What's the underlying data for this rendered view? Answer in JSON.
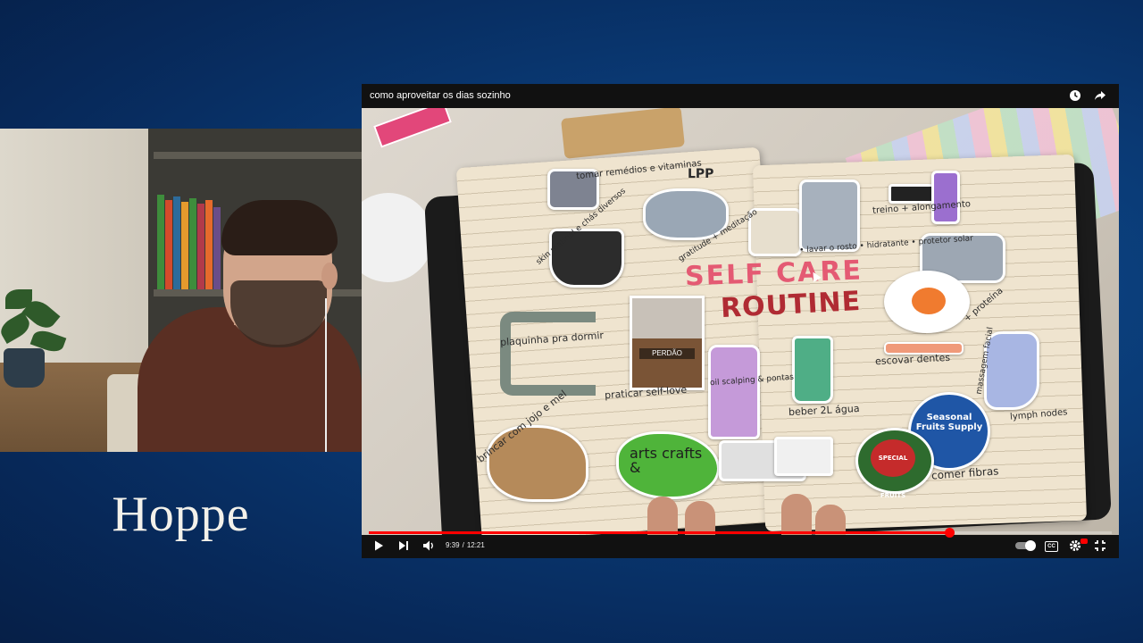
{
  "channel": {
    "name": "Hoppe"
  },
  "player": {
    "title": "como aproveitar os dias sozinho",
    "current_time": "9:39",
    "separator": "/",
    "duration": "12:21",
    "progress": 0.781,
    "icons": {
      "watch_later": "clock-icon",
      "share": "share-icon",
      "play": "play-icon",
      "next": "next-icon",
      "volume": "volume-icon",
      "autoplay": "autoplay-toggle",
      "captions": "captions-icon",
      "settings": "gear-icon",
      "fullscreen_exit": "exit-fullscreen-icon"
    },
    "cc_label": "CC",
    "accent": "#ff0000"
  },
  "journal": {
    "heading_line1": "SELF CARE",
    "heading_line2": "ROUTINE",
    "notes": {
      "remedios": "tomar remédios e vitaminas",
      "gratitude": "gratitude + meditação",
      "skincare": "skin matinal e chás diversos",
      "plaquinha": "plaquinha pra dormir",
      "praticar": "praticar self-love",
      "brincar": "brincar com jojo e mel",
      "arts": "arts crafts &",
      "oil": "oil scalping & pontas",
      "beber": "beber 2L água",
      "escovar": "escovar dentes",
      "lymph": "lymph nodes",
      "massagem": "massagem facial",
      "proteina": "+ proteína",
      "treino": "treino + alongamento",
      "rosto": "• lavar o rosto • hidratante • protetor solar",
      "fibras": "comer fibras",
      "perdao": "PERDÃO",
      "seasonal": "Seasonal Fruits Supply",
      "special": "SPECIAL FRUITS",
      "lpp": "LPP"
    }
  }
}
